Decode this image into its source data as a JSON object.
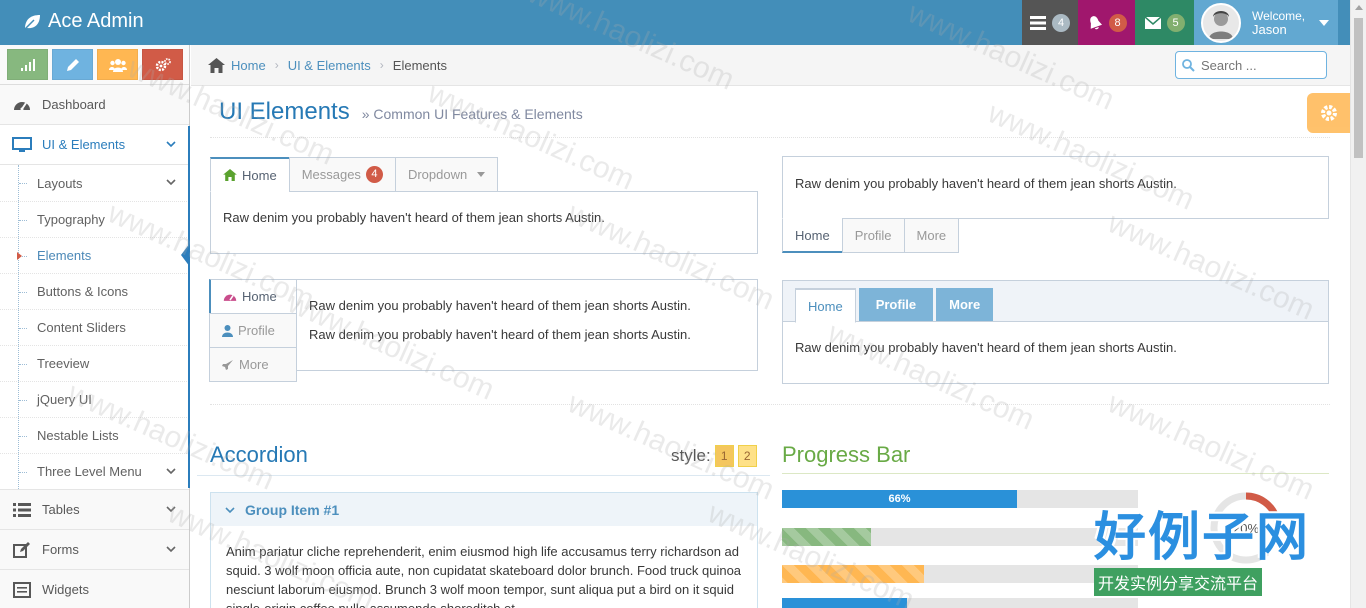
{
  "navbar": {
    "brand": "Ace Admin",
    "tasks_count": "4",
    "notifications_count": "8",
    "messages_count": "5",
    "welcome": "Welcome,",
    "user_name": "Jason",
    "colors": {
      "navbar": "#438eb9",
      "tasks": "#555555",
      "notifications": "#a0176d",
      "messages": "#2e8965",
      "user": "#62a8d1"
    }
  },
  "sidebar": {
    "shortcuts": [
      {
        "icon": "signal-icon",
        "color": "#87b87f"
      },
      {
        "icon": "pencil-icon",
        "color": "#6fb3e0"
      },
      {
        "icon": "group-icon",
        "color": "#ffb752"
      },
      {
        "icon": "cogs-icon",
        "color": "#d15b47"
      }
    ],
    "items": {
      "dashboard": "Dashboard",
      "ui_elements": "UI & Elements",
      "tables": "Tables",
      "forms": "Forms",
      "widgets": "Widgets"
    },
    "submenu": [
      "Layouts",
      "Typography",
      "Elements",
      "Buttons & Icons",
      "Content Sliders",
      "Treeview",
      "jQuery UI",
      "Nestable Lists",
      "Three Level Menu"
    ]
  },
  "breadcrumb": {
    "home": "Home",
    "section": "UI & Elements",
    "current": "Elements"
  },
  "search": {
    "placeholder": "Search ..."
  },
  "page": {
    "title": "UI Elements",
    "subtitle": "» Common UI Features & Elements"
  },
  "tabs1": {
    "home": "Home",
    "messages": "Messages",
    "messages_badge": "4",
    "dropdown": "Dropdown",
    "content": "Raw denim you probably haven't heard of them jean shorts Austin."
  },
  "tabs2": {
    "content": "Raw denim you probably haven't heard of them jean shorts Austin.",
    "home": "Home",
    "profile": "Profile",
    "more": "More"
  },
  "tabs3": {
    "home": "Home",
    "profile": "Profile",
    "more": "More",
    "line1": "Raw denim you probably haven't heard of them jean shorts Austin.",
    "line2": "Raw denim you probably haven't heard of them jean shorts Austin."
  },
  "tabs4": {
    "home": "Home",
    "profile": "Profile",
    "more": "More",
    "content": "Raw denim you probably haven't heard of them jean shorts Austin."
  },
  "accordion": {
    "title": "Accordion",
    "style_label": "style:",
    "style_options": [
      "1",
      "2"
    ],
    "group_title": "Group Item #1",
    "group_body": "Anim pariatur cliche reprehenderit, enim eiusmod high life accusamus terry richardson ad squid. 3 wolf moon officia aute, non cupidatat skateboard dolor brunch. Food truck quinoa nesciunt laborum eiusmod. Brunch 3 wolf moon tempor, sunt aliqua put a bird on it squid single-origin coffee nulla assumenda shoreditch et."
  },
  "progress": {
    "title": "Progress Bar",
    "bars": [
      {
        "value": 0.66,
        "label": "66%",
        "color": "#2a91d8",
        "striped": false
      },
      {
        "value": 0.25,
        "label": "",
        "color": "#87b87f",
        "striped": true
      },
      {
        "value": 0.4,
        "label": "",
        "color": "#ffb752",
        "striped": true
      },
      {
        "value": 0.35,
        "label": "",
        "color": "#2a91d8",
        "striped": false
      }
    ],
    "circle_label": "20%",
    "circle_value": 0.2
  },
  "watermark": {
    "text": "www.haolizi.com",
    "logo_big": "好例子网",
    "logo_small": "开发实例分享交流平台"
  }
}
